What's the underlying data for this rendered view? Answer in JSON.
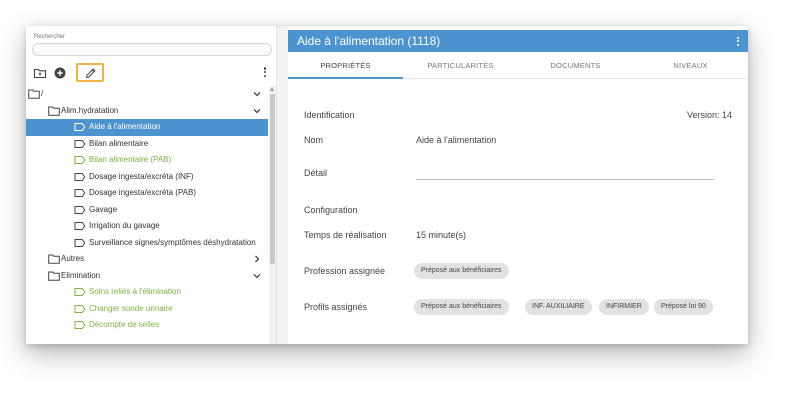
{
  "search": {
    "label": "Rechercher",
    "placeholder": ""
  },
  "toolbar": {
    "icons": [
      "folder-add-icon",
      "add-circle-icon",
      "pencil-icon",
      "more-vertical-icon"
    ]
  },
  "tree": {
    "root": "/",
    "items": [
      {
        "label": "Alim.hydratation",
        "type": "folder",
        "expanded": true
      },
      {
        "label": "Aide à l'alimentation",
        "type": "tag",
        "selected": true
      },
      {
        "label": "Bilan alimentaire",
        "type": "tag"
      },
      {
        "label": "Bilan alimentaire (PAB)",
        "type": "tag",
        "green": true
      },
      {
        "label": "Dosage ingesta/excréta (INF)",
        "type": "tag"
      },
      {
        "label": "Dosage ingesta/excréta (PAB)",
        "type": "tag"
      },
      {
        "label": "Gavage",
        "type": "tag"
      },
      {
        "label": "Irrigation du gavage",
        "type": "tag"
      },
      {
        "label": "Surveillance signes/symptômes déshydratation",
        "type": "tag"
      },
      {
        "label": "Autres",
        "type": "folder",
        "expanded": false
      },
      {
        "label": "Elimination",
        "type": "folder",
        "expanded": true
      },
      {
        "label": "Soins reliés à l'élimination",
        "type": "tag",
        "green": true
      },
      {
        "label": "Changer sonde urinaire",
        "type": "tag",
        "green": true
      },
      {
        "label": "Décompte de selles",
        "type": "tag",
        "green": true
      }
    ]
  },
  "detail": {
    "title": "Aide à l'alimentation (1118)",
    "tabs": [
      "PROPRIÉTÉS",
      "PARTICULARITÉS",
      "DOCUMENTS",
      "NIVEAUX"
    ],
    "identification_label": "Identification",
    "version": "Version: 14",
    "nom_label": "Nom",
    "nom_value": "Aide à l'alimentation",
    "detail_label": "Détail",
    "configuration_label": "Configuration",
    "temps_label": "Temps de réalisation",
    "temps_value": "15 minute(s)",
    "profession_label": "Profession assignée",
    "profession_value": "Préposé aux bénéficiaires",
    "profils_label": "Profils assignés",
    "profils": [
      "Préposé aux bénéficiaires",
      "INF. AUXILIAIRE",
      "INFIRMIER",
      "Préposé loi 90"
    ]
  },
  "colors": {
    "accent": "#4d93cf",
    "green": "#7cb342",
    "highlight": "#f0b240"
  }
}
